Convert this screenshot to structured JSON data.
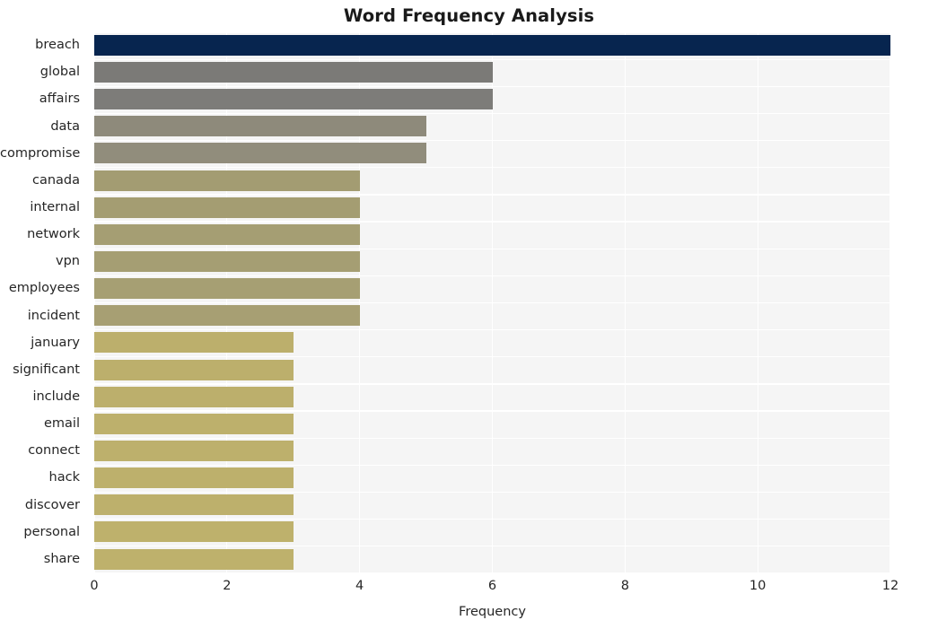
{
  "chart_data": {
    "type": "bar",
    "orientation": "horizontal",
    "title": "Word Frequency Analysis",
    "xlabel": "Frequency",
    "ylabel": "",
    "xlim": [
      0,
      12
    ],
    "ylim": [
      0,
      20
    ],
    "xticks": [
      0,
      2,
      4,
      6,
      8,
      10,
      12
    ],
    "xtick_labels": [
      "0",
      "2",
      "4",
      "6",
      "8",
      "10",
      "12"
    ],
    "grid": true,
    "legend": null,
    "categories": [
      "breach",
      "global",
      "affairs",
      "data",
      "compromise",
      "canada",
      "internal",
      "network",
      "vpn",
      "employees",
      "incident",
      "january",
      "significant",
      "include",
      "email",
      "connect",
      "hack",
      "discover",
      "personal",
      "share"
    ],
    "values": [
      12,
      6,
      6,
      5,
      5,
      4,
      4,
      4,
      4,
      4,
      4,
      3,
      3,
      3,
      3,
      3,
      3,
      3,
      3,
      3
    ],
    "bar_colors": [
      "#07254f",
      "#7b7a77",
      "#7d7c79",
      "#8e8a7b",
      "#918d7c",
      "#a39c72",
      "#a49d72",
      "#a59e73",
      "#a59e73",
      "#a69f73",
      "#a79f73",
      "#bcaf6c",
      "#bcaf6c",
      "#bcaf6c",
      "#bdb06c",
      "#bdb06c",
      "#bdb06c",
      "#bdb06c",
      "#beb16c",
      "#beb16c"
    ],
    "plot_background": "#f5f5f5",
    "grid_color": "#ffffff",
    "figure_background": "#ffffff",
    "text_color": "#262626"
  }
}
